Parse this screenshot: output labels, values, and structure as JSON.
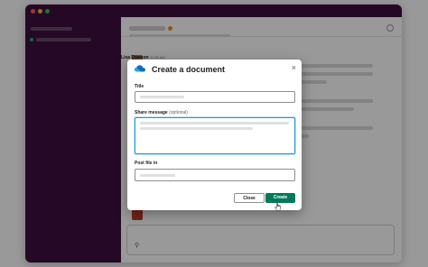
{
  "conversation": {
    "message": {
      "author": "Lisa Dawson",
      "time": "11:55 AM"
    }
  },
  "dialog": {
    "title": "Create a document",
    "close_symbol": "×",
    "app_icon": "cloud-icon",
    "fields": {
      "title_label": "Title",
      "share_label": "Share message",
      "share_optional": "(optional)",
      "post_label": "Post file in"
    },
    "buttons": {
      "close": "Close",
      "create": "Create"
    }
  },
  "composer": {
    "attach_icon": "attachment-icon",
    "attach_symbol": "⚲"
  },
  "colors": {
    "sidebar": "#3f0e40",
    "primary_button": "#007a5a",
    "focus_border": "#1d9bd1",
    "cloud_icon": "#0f6cbd"
  }
}
